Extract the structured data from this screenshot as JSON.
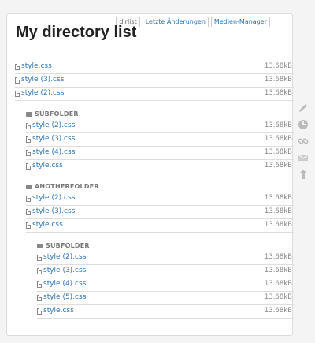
{
  "tabs": [
    "dirlist",
    "Letzte Änderungen",
    "Medien-Manager"
  ],
  "page_title": "My directory list",
  "root_files": [
    {
      "name": "style.css",
      "size": "13.68kB"
    },
    {
      "name": "style (3).css",
      "size": "13.68kB"
    },
    {
      "name": "style (2).css",
      "size": "13.68kB"
    }
  ],
  "subfolder1": {
    "name": "SUBFOLDER",
    "files": [
      {
        "name": "style (2).css",
        "size": "13.68kB"
      },
      {
        "name": "style (3).css",
        "size": "13.68kB"
      },
      {
        "name": "style (4).css",
        "size": "13.68kB"
      },
      {
        "name": "style.css",
        "size": "13.68kB"
      }
    ]
  },
  "anotherfolder": {
    "name": "ANOTHERFOLDER",
    "files": [
      {
        "name": "style (2).css",
        "size": "13.68kB"
      },
      {
        "name": "style (3).css",
        "size": "13.68kB"
      },
      {
        "name": "style.css",
        "size": "13.68kB"
      }
    ]
  },
  "subfolder2": {
    "name": "SUBFOLDER",
    "files": [
      {
        "name": "style (2).css",
        "size": "13.68kB"
      },
      {
        "name": "style (3).css",
        "size": "13.68kB"
      },
      {
        "name": "style (4).css",
        "size": "13.68kB"
      },
      {
        "name": "style (5).css",
        "size": "13.68kB"
      },
      {
        "name": "style.css",
        "size": "13.68kB"
      }
    ]
  },
  "tools": [
    "edit-pencil-icon",
    "revisions-clock-icon",
    "backlinks-link-icon",
    "subscribe-mail-icon",
    "back-to-top-arrow-icon"
  ]
}
